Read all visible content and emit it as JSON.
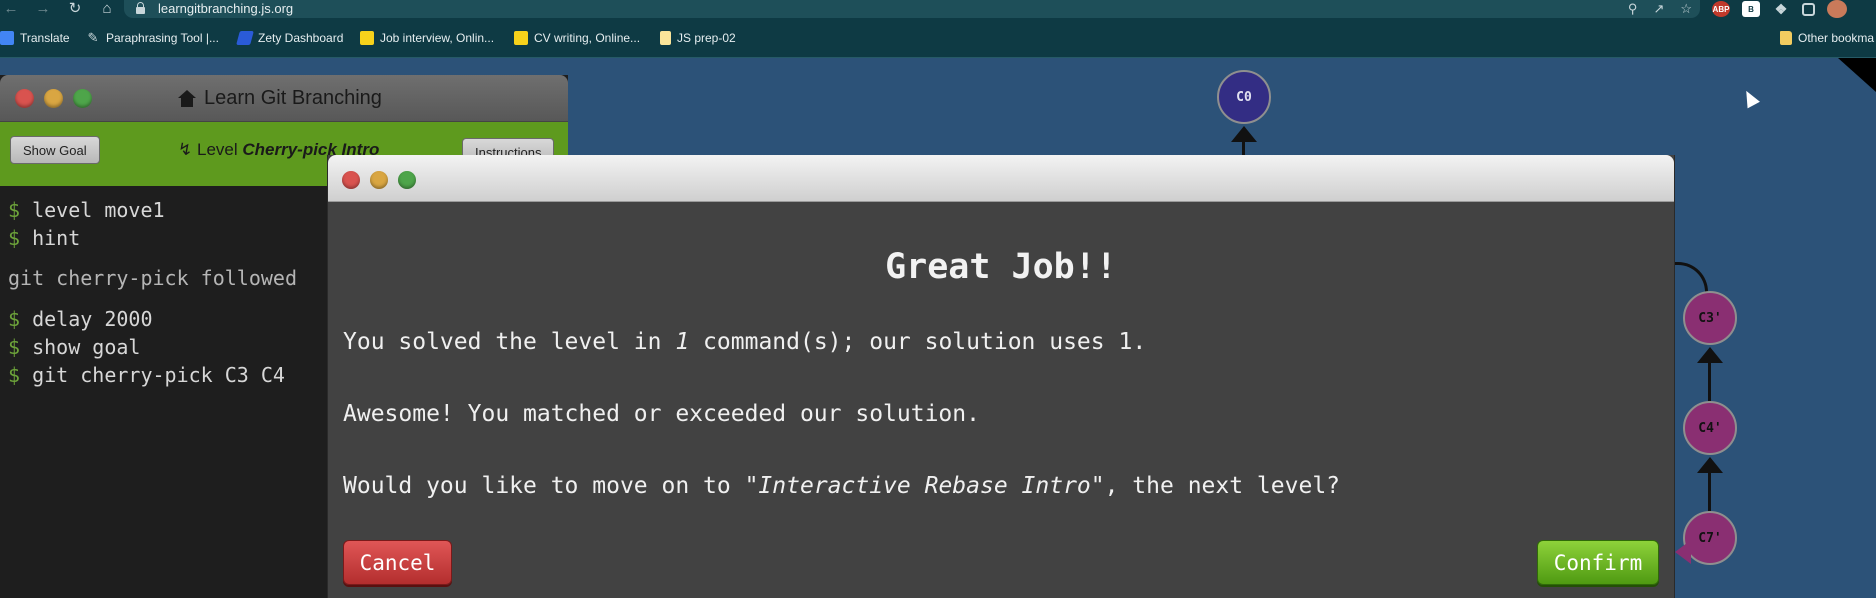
{
  "browser": {
    "url": "learngitbranching.js.org",
    "bookmarks": [
      {
        "label": "Translate",
        "icon": "translate-icon"
      },
      {
        "label": "Paraphrasing Tool |...",
        "icon": "quill-icon"
      },
      {
        "label": "Zety Dashboard",
        "icon": "zety-icon"
      },
      {
        "label": "Job interview, Onlin...",
        "icon": "miro-icon"
      },
      {
        "label": "CV writing, Online...",
        "icon": "miro-icon"
      },
      {
        "label": "JS prep-02",
        "icon": "note-icon"
      },
      {
        "label": "Other bookma",
        "icon": "folder-icon"
      }
    ],
    "extensions": {
      "abp": "ABP",
      "b": "B"
    }
  },
  "app": {
    "title": "Learn Git Branching",
    "show_goal": "Show Goal",
    "level_prefix": "Level",
    "level_name": "Cherry-pick Intro",
    "instructions": "Instructions"
  },
  "terminal": {
    "prompt": "$",
    "lines": [
      "level move1",
      "hint",
      "delay 2000",
      "show goal",
      "git cherry-pick C3 C4"
    ],
    "hint_text": "git cherry-pick followed"
  },
  "graph": {
    "nodes": [
      "C0",
      "C3'",
      "C4'",
      "C7'"
    ]
  },
  "modal": {
    "heading": "Great Job!!",
    "p1_before": "You solved the level in ",
    "p1_count": "1",
    "p1_after": " command(s); our solution uses 1.",
    "p2": "Awesome! You matched or exceeded our solution.",
    "p3_before": "Would you like to move on to ",
    "p3_level": "\"Interactive Rebase Intro\"",
    "p3_after": ", the next level?",
    "cancel": "Cancel",
    "confirm": "Confirm"
  },
  "colors": {
    "background": "#2c5278",
    "toolbar_green": "#5e9a1e",
    "node_purple": "#8a2f72",
    "node_c0": "#332d84",
    "cancel_red": "#c43c3c",
    "confirm_green": "#6cb626"
  }
}
